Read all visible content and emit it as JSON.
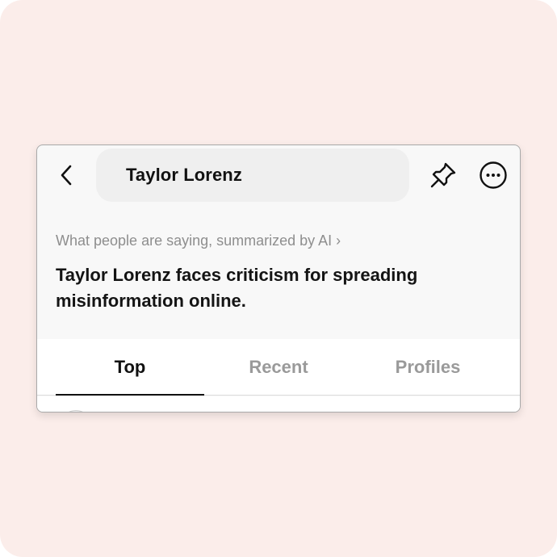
{
  "header": {
    "back_icon": "chevron-left-icon",
    "search_query": "Taylor Lorenz",
    "pin_icon": "pin-icon",
    "more_icon": "more-horizontal-circle-icon"
  },
  "summary": {
    "link_label": "What people are saying, summarized by AI ›",
    "text": "Taylor Lorenz faces criticism for spreading misinformation online."
  },
  "tabs": [
    {
      "label": "Top",
      "selected": true
    },
    {
      "label": "Recent",
      "selected": false
    },
    {
      "label": "Profiles",
      "selected": false
    }
  ],
  "colors": {
    "backdrop": "#fbedea",
    "card": "#f8f8f8",
    "search_pill": "#efefef",
    "active_tab": "#111111",
    "inactive_tab": "#9a9a9a"
  }
}
